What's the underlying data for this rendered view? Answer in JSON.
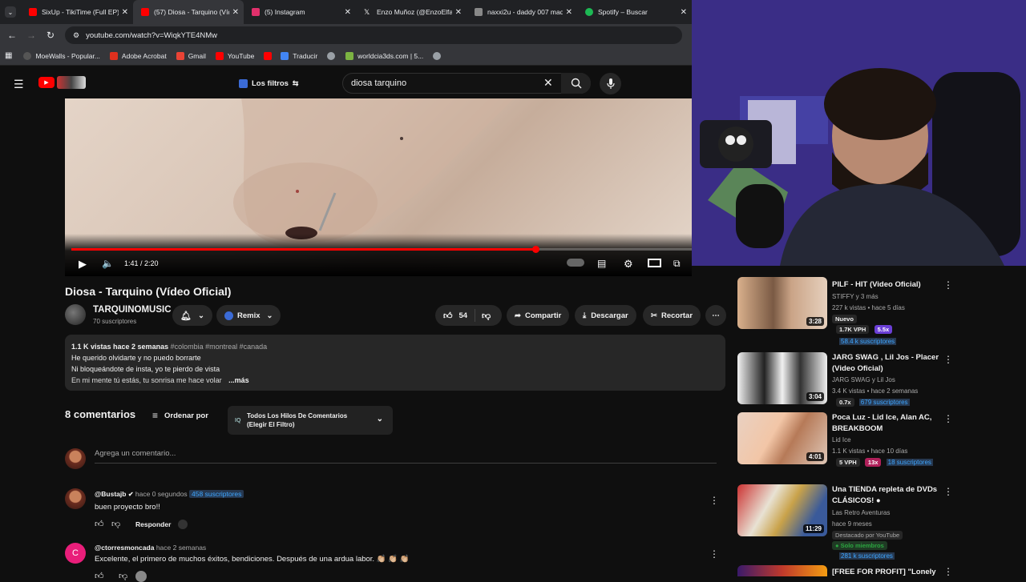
{
  "tabs": [
    {
      "title": "SixUp - TikiTime (Full EP)",
      "color": "#ff0000"
    },
    {
      "title": "(57) Diosa - Tarquino (Vídeo",
      "color": "#ff0000",
      "active": true
    },
    {
      "title": "(5) Instagram",
      "color": "#e1306c"
    },
    {
      "title": "Enzo Muñoz (@EnzoElfacha",
      "color": "#ffffff"
    },
    {
      "title": "naxxi2u - daddy 007 maquina",
      "color": "#888888"
    },
    {
      "title": "Spotify – Buscar",
      "color": "#1db954"
    }
  ],
  "address": {
    "url": "youtube.com/watch?v=WiqkYTE4NMw"
  },
  "bookmarks": [
    {
      "label": "MoeWalls - Popular...",
      "color": "#555555"
    },
    {
      "label": "Adobe Acrobat",
      "color": "#e0301e"
    },
    {
      "label": "Gmail",
      "color": "#ea4335"
    },
    {
      "label": "YouTube",
      "color": "#ff0000"
    },
    {
      "label": "",
      "color": "#ff0000"
    },
    {
      "label": "Traducir",
      "color": "#4285f4"
    },
    {
      "label": "",
      "color": "#9aa0a6"
    },
    {
      "label": "worldcia3ds.com | 5...",
      "color": "#7cb342"
    },
    {
      "label": "",
      "color": "#9aa0a6"
    }
  ],
  "youtube": {
    "filters_label": "Los filtros",
    "search_value": "diosa tarquino"
  },
  "player": {
    "time": "1:41 / 2:20",
    "progress": 0.75
  },
  "video": {
    "title": "Diosa - Tarquino (Vídeo Oficial)",
    "channel": "TARQUINOMUSIC",
    "subscribers": "70 suscriptores",
    "remix_label": "Remix",
    "likes": "54",
    "share_label": "Compartir",
    "download_label": "Descargar",
    "clip_label": "Recortar"
  },
  "description": {
    "stats": "1.1 K vistas  hace 2 semanas",
    "tags": "#colombia #montreal #canada",
    "line1": "He querido olvidarte y no puedo borrarte",
    "line2": "Ni bloqueándote de insta, yo te pierdo de vista",
    "line3": "En mi mente tú estás, tu sonrisa me hace volar",
    "more": "...más"
  },
  "comments": {
    "count": "8 comentarios",
    "sort_label": "Ordenar por",
    "filter_line1": "Todos Los Hilos De Comentarios",
    "filter_line2": "(Elegir El Filtro)",
    "add_placeholder": "Agrega un comentario...",
    "items": [
      {
        "author": "@Bustajb",
        "time": "hace 0 segundos",
        "subs": "458 suscriptores",
        "text": "buen proyecto bro!!",
        "reply": "Responder"
      },
      {
        "author": "@ctorresmoncada",
        "time": "hace 2 semanas",
        "text": "Excelente, el primero de muchos éxitos, bendiciones. Después de una ardua labor. 👏🏼 👏🏼 👏🏼",
        "avatar_letter": "C"
      }
    ]
  },
  "recommended": [
    {
      "title": "PILF - HIT (Video Oficial)",
      "channel": "STIFFY y 3 más",
      "meta": "227 k vistas • hace 5 días",
      "duration": "3:28",
      "badges": [
        "Nuevo"
      ],
      "vph": "1.7K VPH",
      "ratio": "5.5x",
      "subs": "58.4 k suscriptores"
    },
    {
      "title": "JARG SWAG , Lil Jos - Placer (Video Oficial)",
      "channel": "JARG SWAG y Lil Jos",
      "meta": "3.4 K vistas • hace 2 semanas",
      "duration": "3:04",
      "ratio": "0.7x",
      "subs": "679 suscriptores"
    },
    {
      "title": "Poca Luz - Lid Ice, Alan AC, BREAKBOOM",
      "channel": "Lid Ice",
      "meta": "1.1 K vistas • hace 10 días",
      "duration": "4:01",
      "vph": "5 VPH",
      "ratio": "13x",
      "subs": "18 suscriptores"
    },
    {
      "title": "Una TIENDA repleta de DVDs CLÁSICOS! ●",
      "channel": "Las Retro Aventuras",
      "meta": "hace 9 meses",
      "duration": "11:29",
      "sponsored": "Destacado por YouTube",
      "members": "Solo miembros",
      "subs": "281 k suscriptores"
    },
    {
      "title": "[FREE FOR PROFIT] \"Lonely"
    }
  ]
}
